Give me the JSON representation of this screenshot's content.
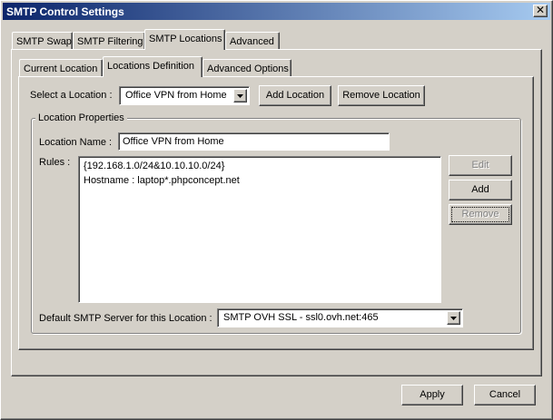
{
  "window": {
    "title": "SMTP Control Settings",
    "close_glyph": "✕"
  },
  "main_tabs": [
    {
      "label": "SMTP Swap"
    },
    {
      "label": "SMTP Filtering"
    },
    {
      "label": "SMTP Locations"
    },
    {
      "label": "Advanced"
    }
  ],
  "sub_tabs": [
    {
      "label": "Current Location"
    },
    {
      "label": "Locations Definition"
    },
    {
      "label": "Advanced Options"
    }
  ],
  "select_location": {
    "label": "Select a Location :",
    "value": "Office VPN from Home"
  },
  "add_location_label": "Add Location",
  "remove_location_label": "Remove Location",
  "location_properties": {
    "title": "Location Properties",
    "name_label": "Location Name :",
    "name_value": "Office VPN from Home",
    "rules_label": "Rules :",
    "rules": [
      "{192.168.1.0/24&10.10.10.0/24}",
      "Hostname : laptop*.phpconcept.net"
    ],
    "edit_label": "Edit",
    "add_label": "Add",
    "remove_label": "Remove",
    "default_server_label": "Default SMTP Server for this Location :",
    "default_server_value": "SMTP OVH SSL - ssl0.ovh.net:465"
  },
  "apply_label": "Apply",
  "cancel_label": "Cancel",
  "colors": {
    "face": "#d4d0c8",
    "title_start": "#0a246a",
    "title_end": "#a6caf0",
    "disabled_text": "#808080"
  },
  "icons": {
    "close": "close-icon",
    "dropdown": "chevron-down-icon"
  }
}
